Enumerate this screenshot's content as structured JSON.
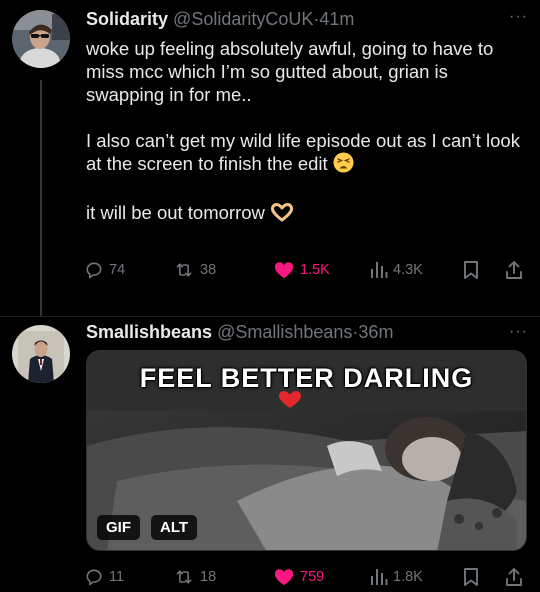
{
  "tweets": [
    {
      "author": {
        "name": "Solidarity",
        "handle": "@SolidarityCoUK",
        "time": "41m"
      },
      "separator": "·",
      "more": "···",
      "text": {
        "p1": "woke up feeling absolutely awful, going to have to miss mcc which I’m so gutted about, grian is swapping in for me..",
        "p2": "I also can’t get my wild life episode out as I can’t look at the screen to finish the edit",
        "p3": "it will be out tomorrow"
      },
      "stats": {
        "replies": "74",
        "reposts": "38",
        "likes": "1.5K",
        "views": "4.3K"
      },
      "liked": true
    },
    {
      "author": {
        "name": "Smallishbeans",
        "handle": "@Smallishbeans",
        "time": "36m"
      },
      "separator": "·",
      "more": "···",
      "media": {
        "caption": "FEEL BETTER DARLING",
        "gif_badge": "GIF",
        "alt_badge": "ALT"
      },
      "stats": {
        "replies": "11",
        "reposts": "18",
        "likes": "759",
        "views": "1.8K"
      },
      "liked": true
    }
  ],
  "colors": {
    "like": "#f91880",
    "muted": "#71767b",
    "text": "#e7e9ea",
    "background": "#000000"
  }
}
